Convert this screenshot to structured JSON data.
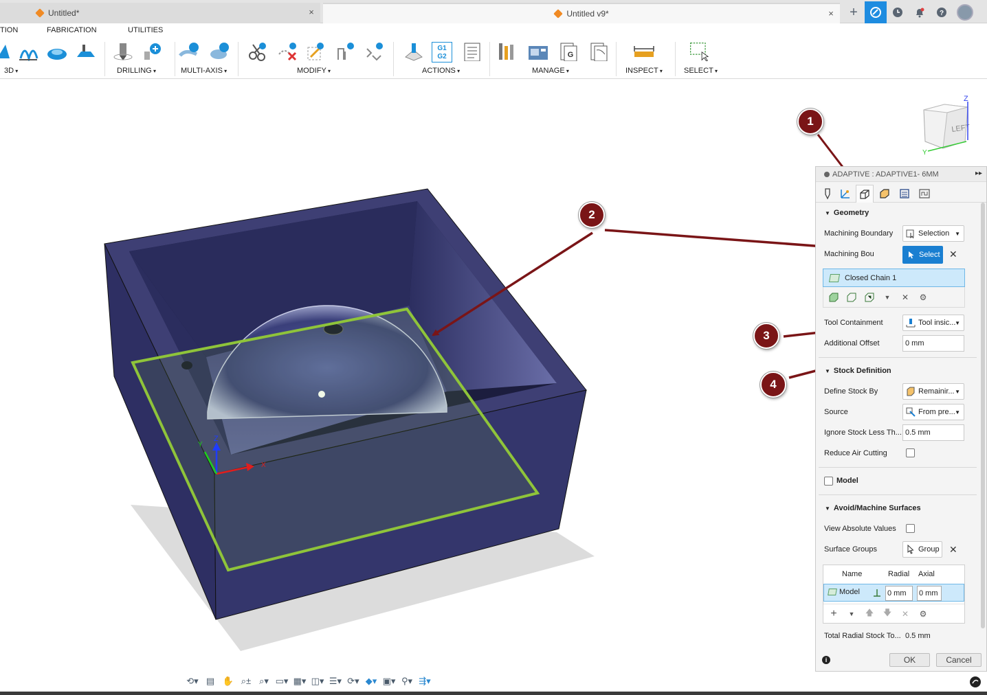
{
  "tabs": {
    "inactive_label": "Untitled*",
    "active_label": "Untitled v9*",
    "close_icon": "×",
    "add_icon": "+"
  },
  "topbar_icons": [
    "fusion-extension-icon",
    "clock-icon",
    "bell-icon",
    "help-icon",
    "avatar"
  ],
  "ribbon": {
    "tabs": [
      "TION",
      "FABRICATION",
      "UTILITIES"
    ],
    "groups": [
      "3D",
      "DRILLING",
      "MULTI-AXIS",
      "MODIFY",
      "ACTIONS",
      "MANAGE",
      "INSPECT",
      "SELECT"
    ],
    "g1g2_label_top": "G1",
    "g1g2_label_bottom": "G2",
    "g_doc_label": "G"
  },
  "viewcube": {
    "face_label": "LEFT",
    "axis_z": "Z",
    "axis_y": "Y"
  },
  "triad": {
    "z_label": "Z",
    "x_label": "X",
    "y_label": "Y"
  },
  "annotations": [
    "1",
    "2",
    "3",
    "4"
  ],
  "panel": {
    "title": "ADAPTIVE : ADAPTIVE1- 6MM",
    "expand_icon": "▸▸",
    "geometry": {
      "heading": "Geometry",
      "machining_boundary_label": "Machining Boundary",
      "machining_boundary_value": "Selection",
      "boundary_select_label": "Machining Bou",
      "select_button": "Select",
      "chain_item": "Closed Chain 1",
      "tool_containment_label": "Tool Containment",
      "tool_containment_value": "Tool insic...",
      "additional_offset_label": "Additional Offset",
      "additional_offset_value": "0 mm"
    },
    "stock": {
      "heading": "Stock Definition",
      "define_stock_label": "Define Stock By",
      "define_stock_value": "Remainir...",
      "source_label": "Source",
      "source_value": "From pre...",
      "ignore_label": "Ignore Stock Less Th...",
      "ignore_value": "0.5 mm",
      "reduce_air_label": "Reduce Air Cutting"
    },
    "model": {
      "heading": "Model"
    },
    "avoid": {
      "heading": "Avoid/Machine Surfaces",
      "view_abs_label": "View Absolute Values",
      "surface_groups_label": "Surface Groups",
      "group_button": "Group",
      "col_name": "Name",
      "col_radial": "Radial",
      "col_axial": "Axial",
      "row_name": "Model",
      "row_radial": "0 mm",
      "row_axial": "0 mm",
      "total_label": "Total Radial Stock To...",
      "total_value": "0.5 mm"
    },
    "ok_button": "OK",
    "cancel_button": "Cancel"
  },
  "colors": {
    "box_dark": "#2e2f63",
    "box_side": "#3e3f74",
    "boundary_green": "#8fc43a",
    "arrow_red": "#7a1517",
    "accent_blue": "#1a7fd1"
  }
}
